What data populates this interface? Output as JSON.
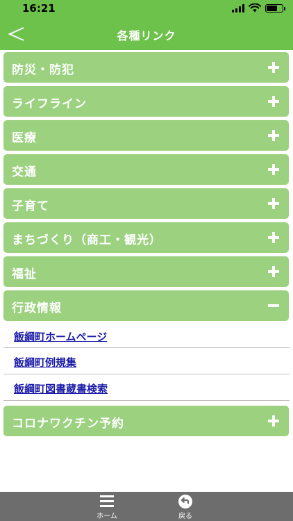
{
  "status": {
    "time": "16:21"
  },
  "header": {
    "title": "各種リンク"
  },
  "items": [
    {
      "label": "防災・防犯",
      "state": "collapsed"
    },
    {
      "label": "ライフライン",
      "state": "collapsed"
    },
    {
      "label": "医療",
      "state": "collapsed"
    },
    {
      "label": "交通",
      "state": "collapsed"
    },
    {
      "label": "子育て",
      "state": "collapsed"
    },
    {
      "label": "まちづくり（商工・観光）",
      "state": "collapsed"
    },
    {
      "label": "福祉",
      "state": "collapsed"
    },
    {
      "label": "行政情報",
      "state": "expanded"
    },
    {
      "label": "コロナワクチン予約",
      "state": "collapsed"
    }
  ],
  "sublinks": [
    "飯綱町ホームページ",
    "飯綱町例規集",
    "飯綱町図書蔵書検索"
  ],
  "tabbar": {
    "home_label": "ホーム",
    "back_label": "戻る"
  },
  "colors": {
    "accent": "#6cc24a",
    "item_bg": "#9bd17f",
    "link": "#1a1aa8",
    "tabbar": "#6d6d6d"
  }
}
